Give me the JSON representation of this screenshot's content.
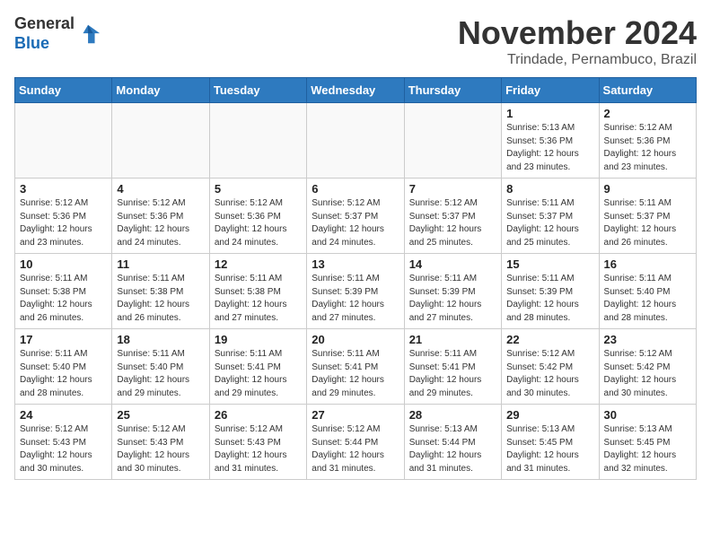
{
  "header": {
    "logo_line1": "General",
    "logo_line2": "Blue",
    "month": "November 2024",
    "location": "Trindade, Pernambuco, Brazil"
  },
  "weekdays": [
    "Sunday",
    "Monday",
    "Tuesday",
    "Wednesday",
    "Thursday",
    "Friday",
    "Saturday"
  ],
  "weeks": [
    [
      {
        "day": "",
        "info": ""
      },
      {
        "day": "",
        "info": ""
      },
      {
        "day": "",
        "info": ""
      },
      {
        "day": "",
        "info": ""
      },
      {
        "day": "",
        "info": ""
      },
      {
        "day": "1",
        "info": "Sunrise: 5:13 AM\nSunset: 5:36 PM\nDaylight: 12 hours\nand 23 minutes."
      },
      {
        "day": "2",
        "info": "Sunrise: 5:12 AM\nSunset: 5:36 PM\nDaylight: 12 hours\nand 23 minutes."
      }
    ],
    [
      {
        "day": "3",
        "info": "Sunrise: 5:12 AM\nSunset: 5:36 PM\nDaylight: 12 hours\nand 23 minutes."
      },
      {
        "day": "4",
        "info": "Sunrise: 5:12 AM\nSunset: 5:36 PM\nDaylight: 12 hours\nand 24 minutes."
      },
      {
        "day": "5",
        "info": "Sunrise: 5:12 AM\nSunset: 5:36 PM\nDaylight: 12 hours\nand 24 minutes."
      },
      {
        "day": "6",
        "info": "Sunrise: 5:12 AM\nSunset: 5:37 PM\nDaylight: 12 hours\nand 24 minutes."
      },
      {
        "day": "7",
        "info": "Sunrise: 5:12 AM\nSunset: 5:37 PM\nDaylight: 12 hours\nand 25 minutes."
      },
      {
        "day": "8",
        "info": "Sunrise: 5:11 AM\nSunset: 5:37 PM\nDaylight: 12 hours\nand 25 minutes."
      },
      {
        "day": "9",
        "info": "Sunrise: 5:11 AM\nSunset: 5:37 PM\nDaylight: 12 hours\nand 26 minutes."
      }
    ],
    [
      {
        "day": "10",
        "info": "Sunrise: 5:11 AM\nSunset: 5:38 PM\nDaylight: 12 hours\nand 26 minutes."
      },
      {
        "day": "11",
        "info": "Sunrise: 5:11 AM\nSunset: 5:38 PM\nDaylight: 12 hours\nand 26 minutes."
      },
      {
        "day": "12",
        "info": "Sunrise: 5:11 AM\nSunset: 5:38 PM\nDaylight: 12 hours\nand 27 minutes."
      },
      {
        "day": "13",
        "info": "Sunrise: 5:11 AM\nSunset: 5:39 PM\nDaylight: 12 hours\nand 27 minutes."
      },
      {
        "day": "14",
        "info": "Sunrise: 5:11 AM\nSunset: 5:39 PM\nDaylight: 12 hours\nand 27 minutes."
      },
      {
        "day": "15",
        "info": "Sunrise: 5:11 AM\nSunset: 5:39 PM\nDaylight: 12 hours\nand 28 minutes."
      },
      {
        "day": "16",
        "info": "Sunrise: 5:11 AM\nSunset: 5:40 PM\nDaylight: 12 hours\nand 28 minutes."
      }
    ],
    [
      {
        "day": "17",
        "info": "Sunrise: 5:11 AM\nSunset: 5:40 PM\nDaylight: 12 hours\nand 28 minutes."
      },
      {
        "day": "18",
        "info": "Sunrise: 5:11 AM\nSunset: 5:40 PM\nDaylight: 12 hours\nand 29 minutes."
      },
      {
        "day": "19",
        "info": "Sunrise: 5:11 AM\nSunset: 5:41 PM\nDaylight: 12 hours\nand 29 minutes."
      },
      {
        "day": "20",
        "info": "Sunrise: 5:11 AM\nSunset: 5:41 PM\nDaylight: 12 hours\nand 29 minutes."
      },
      {
        "day": "21",
        "info": "Sunrise: 5:11 AM\nSunset: 5:41 PM\nDaylight: 12 hours\nand 29 minutes."
      },
      {
        "day": "22",
        "info": "Sunrise: 5:12 AM\nSunset: 5:42 PM\nDaylight: 12 hours\nand 30 minutes."
      },
      {
        "day": "23",
        "info": "Sunrise: 5:12 AM\nSunset: 5:42 PM\nDaylight: 12 hours\nand 30 minutes."
      }
    ],
    [
      {
        "day": "24",
        "info": "Sunrise: 5:12 AM\nSunset: 5:43 PM\nDaylight: 12 hours\nand 30 minutes."
      },
      {
        "day": "25",
        "info": "Sunrise: 5:12 AM\nSunset: 5:43 PM\nDaylight: 12 hours\nand 30 minutes."
      },
      {
        "day": "26",
        "info": "Sunrise: 5:12 AM\nSunset: 5:43 PM\nDaylight: 12 hours\nand 31 minutes."
      },
      {
        "day": "27",
        "info": "Sunrise: 5:12 AM\nSunset: 5:44 PM\nDaylight: 12 hours\nand 31 minutes."
      },
      {
        "day": "28",
        "info": "Sunrise: 5:13 AM\nSunset: 5:44 PM\nDaylight: 12 hours\nand 31 minutes."
      },
      {
        "day": "29",
        "info": "Sunrise: 5:13 AM\nSunset: 5:45 PM\nDaylight: 12 hours\nand 31 minutes."
      },
      {
        "day": "30",
        "info": "Sunrise: 5:13 AM\nSunset: 5:45 PM\nDaylight: 12 hours\nand 32 minutes."
      }
    ]
  ]
}
